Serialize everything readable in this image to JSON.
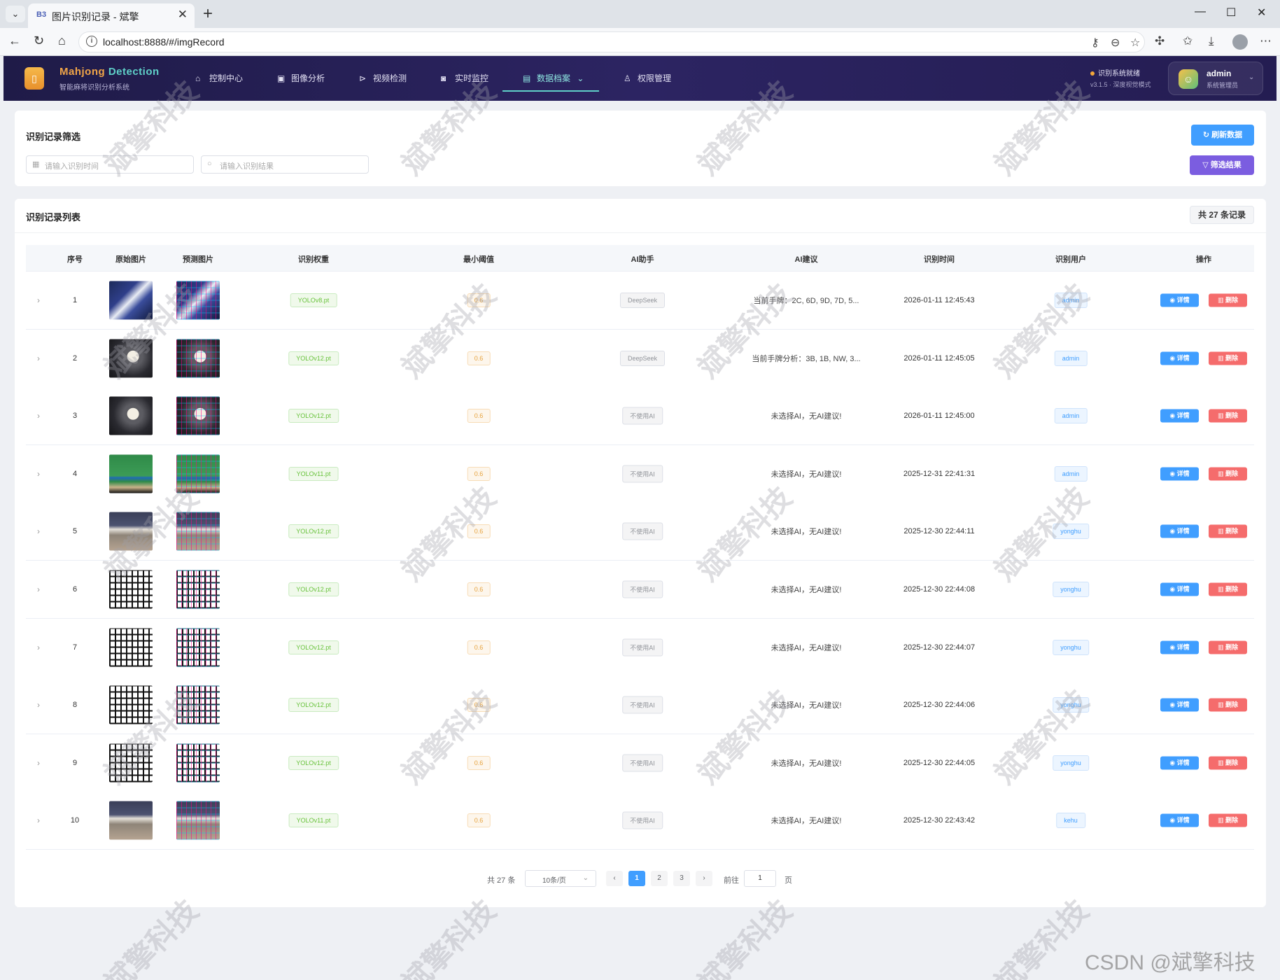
{
  "browser": {
    "tab_favicon": "B3",
    "tab_title": "图片识别记录 - 斌擎",
    "tab_close": "✕",
    "new_tab": "+",
    "url": "localhost:8888/#/imgRecord"
  },
  "header": {
    "logo_icon": "mahjong-tile-icon",
    "brand_part1": "Mahjong",
    "brand_part2": "Detection",
    "brand_sub": "智能麻将识别分析系统",
    "nav": [
      {
        "icon": "home-icon",
        "label": "控制中心",
        "active": false
      },
      {
        "icon": "image-icon",
        "label": "图像分析",
        "active": false
      },
      {
        "icon": "play-icon",
        "label": "视频检测",
        "active": false
      },
      {
        "icon": "camera-icon",
        "label": "实时监控",
        "active": false
      },
      {
        "icon": "document-icon",
        "label": "数据档案",
        "active": true
      },
      {
        "icon": "user-icon",
        "label": "权限管理",
        "active": false
      }
    ],
    "status_text": "识别系统就绪",
    "version_text": "v3.1.5 · 深度视觉模式",
    "user_name": "admin",
    "user_role": "系统管理员"
  },
  "filter": {
    "title": "识别记录筛选",
    "time_placeholder": "请输入识别时间",
    "result_placeholder": "请输入识别结果",
    "refresh_label": "刷新数据",
    "filter_label": "筛选结果"
  },
  "list": {
    "title": "识别记录列表",
    "total_badge": "共 27 条记录",
    "columns": [
      "序号",
      "原始图片",
      "预测图片",
      "识别权重",
      "最小阈值",
      "AI助手",
      "AI建议",
      "识别时间",
      "识别用户",
      "操作"
    ],
    "detail_label": "详情",
    "delete_label": "删除",
    "rows": [
      {
        "index": "1",
        "thumb": "blue",
        "weight": "YOLOv8.pt",
        "threshold": "0.6",
        "ai": "DeepSeek",
        "advice": "当前手牌：2C, 6D, 9D, 7D, 5...",
        "time": "2026-01-11 12:45:43",
        "user": "admin"
      },
      {
        "index": "2",
        "thumb": "dark",
        "weight": "YOLOv12.pt",
        "threshold": "0.6",
        "ai": "DeepSeek",
        "advice": "当前手牌分析：3B, 1B, NW, 3...",
        "time": "2026-01-11 12:45:05",
        "user": "admin"
      },
      {
        "index": "3",
        "thumb": "dark",
        "weight": "YOLOv12.pt",
        "threshold": "0.6",
        "ai": "不使用AI",
        "advice": "未选择AI，无AI建议!",
        "time": "2026-01-11 12:45:00",
        "user": "admin"
      },
      {
        "index": "4",
        "thumb": "green",
        "weight": "YOLOv11.pt",
        "threshold": "0.6",
        "ai": "不使用AI",
        "advice": "未选择AI，无AI建议!",
        "time": "2025-12-31 22:41:31",
        "user": "admin"
      },
      {
        "index": "5",
        "thumb": "table",
        "weight": "YOLOv12.pt",
        "threshold": "0.6",
        "ai": "不使用AI",
        "advice": "未选择AI，无AI建议!",
        "time": "2025-12-30 22:44:11",
        "user": "yonghu"
      },
      {
        "index": "6",
        "thumb": "grid",
        "weight": "YOLOv12.pt",
        "threshold": "0.6",
        "ai": "不使用AI",
        "advice": "未选择AI，无AI建议!",
        "time": "2025-12-30 22:44:08",
        "user": "yonghu"
      },
      {
        "index": "7",
        "thumb": "grid",
        "weight": "YOLOv12.pt",
        "threshold": "0.6",
        "ai": "不使用AI",
        "advice": "未选择AI，无AI建议!",
        "time": "2025-12-30 22:44:07",
        "user": "yonghu"
      },
      {
        "index": "8",
        "thumb": "grid",
        "weight": "YOLOv12.pt",
        "threshold": "0.6",
        "ai": "不使用AI",
        "advice": "未选择AI，无AI建议!",
        "time": "2025-12-30 22:44:06",
        "user": "yonghu"
      },
      {
        "index": "9",
        "thumb": "grid",
        "weight": "YOLOv12.pt",
        "threshold": "0.6",
        "ai": "不使用AI",
        "advice": "未选择AI，无AI建议!",
        "time": "2025-12-30 22:44:05",
        "user": "yonghu"
      },
      {
        "index": "10",
        "thumb": "table",
        "weight": "YOLOv11.pt",
        "threshold": "0.6",
        "ai": "不使用AI",
        "advice": "未选择AI，无AI建议!",
        "time": "2025-12-30 22:43:42",
        "user": "kehu"
      }
    ]
  },
  "pagination": {
    "total_text": "共 27 条",
    "page_size": "10条/页",
    "pages": [
      "1",
      "2",
      "3"
    ],
    "current_page": "1",
    "goto_label": "前往",
    "goto_value": "1",
    "page_suffix": "页"
  },
  "watermark": {
    "text": "斌擎科技",
    "csdn": "CSDN @斌擎科技"
  },
  "colors": {
    "header_bg": "#241d52",
    "primary": "#409eff",
    "filter_button": "#7b5de0",
    "danger": "#f56c6c",
    "active_nav": "#8ee6e0"
  }
}
